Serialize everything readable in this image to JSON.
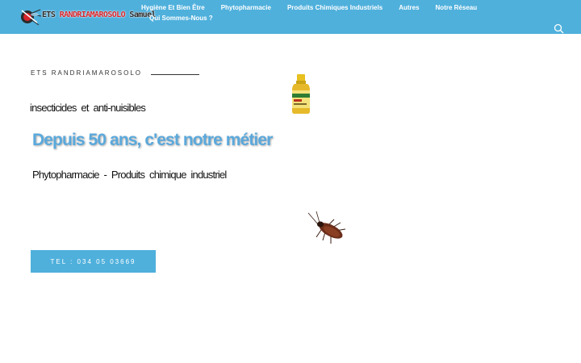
{
  "header": {
    "logo": {
      "prefix": "ETS ",
      "brand": "RANDRIAMAROSOLO",
      "suffix": " Samuel"
    },
    "nav": [
      {
        "label": "Hygiène Et Bien Être"
      },
      {
        "label": "Phytopharmacie"
      },
      {
        "label": "Produits Chimiques Industriels"
      },
      {
        "label": "Autres"
      },
      {
        "label": "Notre Réseau"
      },
      {
        "label": "Qui Sommes-Nous ?"
      }
    ],
    "search_icon": "search-icon"
  },
  "hero": {
    "kicker": "ETS RANDRIAMAROSOLO",
    "line1": "insecticides et anti-nuisibles",
    "headline": "Depuis 50 ans, c'est notre métier",
    "line3": "Phytopharmacie - Produits chimique industriel",
    "cta": "TEL : 034 05 03669"
  },
  "images": {
    "product": "insecticide-bottle",
    "pest": "cockroach"
  },
  "colors": {
    "topbar": "#4fb0dc",
    "headline": "#5aa9dc",
    "text": "#111111",
    "logo_red": "#d6252b"
  }
}
